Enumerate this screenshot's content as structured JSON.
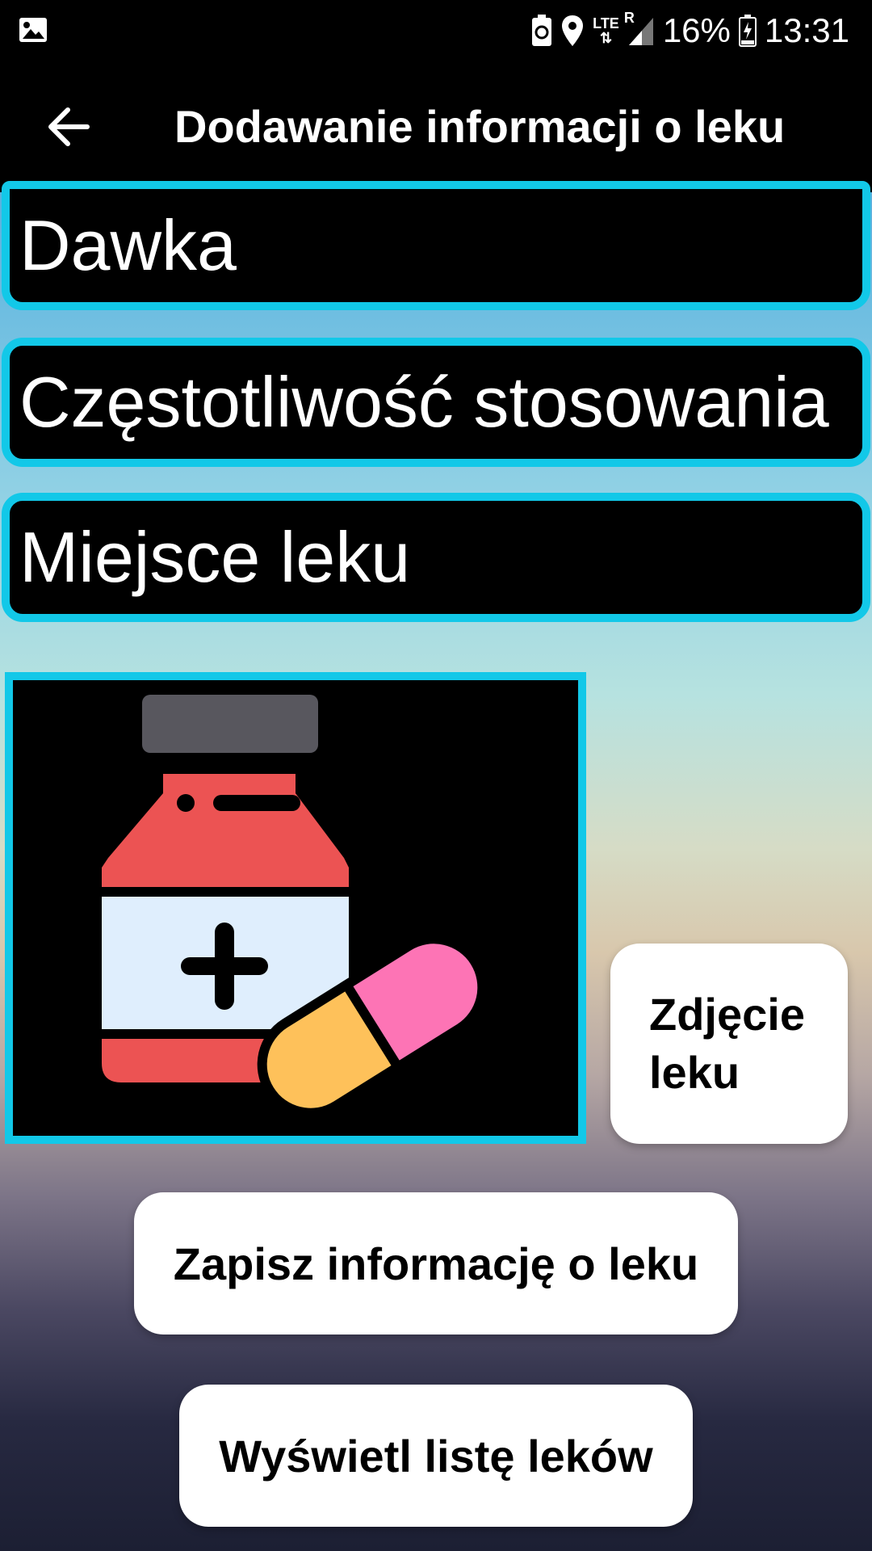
{
  "status_bar": {
    "battery_percent": "16%",
    "time": "13:31",
    "network": "LTE",
    "roaming": "R",
    "icons": [
      "image-icon",
      "battery-saver-icon",
      "location-icon",
      "lte-icon",
      "signal-icon",
      "battery-charging-icon"
    ]
  },
  "app_bar": {
    "back_icon": "arrow-left-icon",
    "title": "Dodawanie informacji o leku"
  },
  "fields": {
    "dose": "Dawka",
    "frequency": "Częstotliwość stosowania",
    "location": "Miejsce leku"
  },
  "image": {
    "icon": "medicine-bottle-pills-icon"
  },
  "buttons": {
    "photo": "Zdjęcie leku",
    "save": "Zapisz informację o leku",
    "list": "Wyświetl listę leków"
  },
  "colors": {
    "accent": "#12c8e8",
    "bar_background": "#000000",
    "button_background": "#ffffff"
  }
}
